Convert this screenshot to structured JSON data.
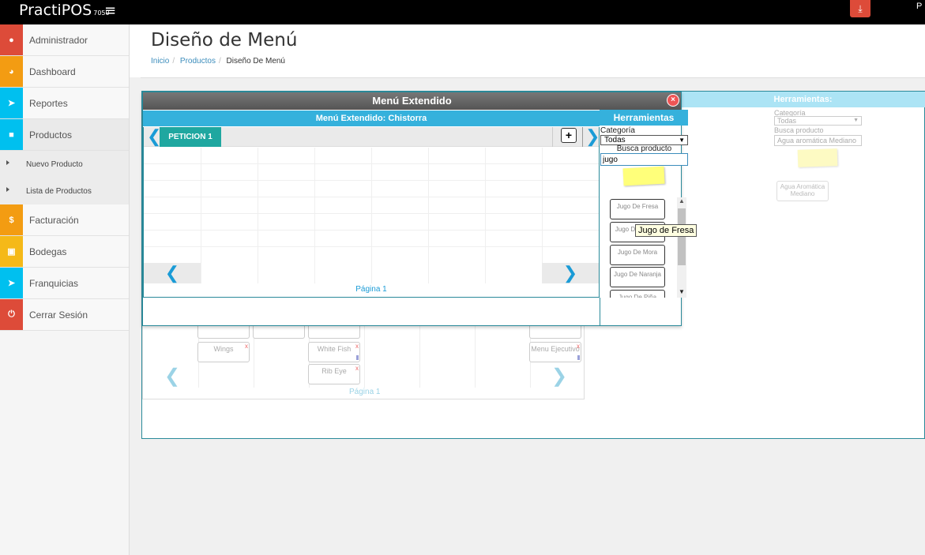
{
  "app": {
    "name": "PractiPOS",
    "version": "7050",
    "user_initial": "P"
  },
  "sidebar": {
    "items": [
      {
        "label": "Administrador",
        "color": "#dd4b39"
      },
      {
        "label": "Dashboard",
        "color": "#f39c12"
      },
      {
        "label": "Reportes",
        "color": "#00c0ef"
      },
      {
        "label": "Productos",
        "color": "#00c0ef"
      },
      {
        "label": "Facturación",
        "color": "#f39c12"
      },
      {
        "label": "Bodegas",
        "color": "#f5b918"
      },
      {
        "label": "Franquicias",
        "color": "#00c0ef"
      },
      {
        "label": "Cerrar Sesión",
        "color": "#dd4b39"
      }
    ],
    "subitems": [
      {
        "label": "Nuevo Producto"
      },
      {
        "label": "Lista de Productos"
      }
    ]
  },
  "page": {
    "title": "Diseño de Menú",
    "breadcrumb": [
      "Inicio",
      "Productos",
      "Diseño De Menú"
    ]
  },
  "background": {
    "tools_title": "Herramientas:",
    "category_label": "Categoría",
    "category_value": "Todas",
    "search_label": "Busca producto",
    "search_value": "Agua aromática Mediano",
    "product": "Agua Aromática Mediano",
    "tiles": [
      "Wings",
      "White Fish",
      "Rib Eye",
      "Menu Ejecutivo"
    ],
    "page_label": "Página 1"
  },
  "dialog": {
    "title": "Menú Extendido",
    "subtitle": "Menú Extendido: Chistorra",
    "tools_title": "Herramientas",
    "tab_label": "PETICION 1",
    "add_label": "+",
    "page_label": "Página 1",
    "category_label": "Categoría",
    "category_value": "Todas",
    "search_label": "Busca producto",
    "search_value": "jugo",
    "products": [
      "Jugo De Fresa",
      "Jugo De Mango",
      "Jugo De Mora",
      "Jugo De Naranja",
      "Jugo De Piña"
    ],
    "tooltip": "Jugo de Fresa"
  },
  "colors": {
    "accent": "#35b1dc",
    "tab": "#1fa7a0",
    "close": "#e55555"
  }
}
